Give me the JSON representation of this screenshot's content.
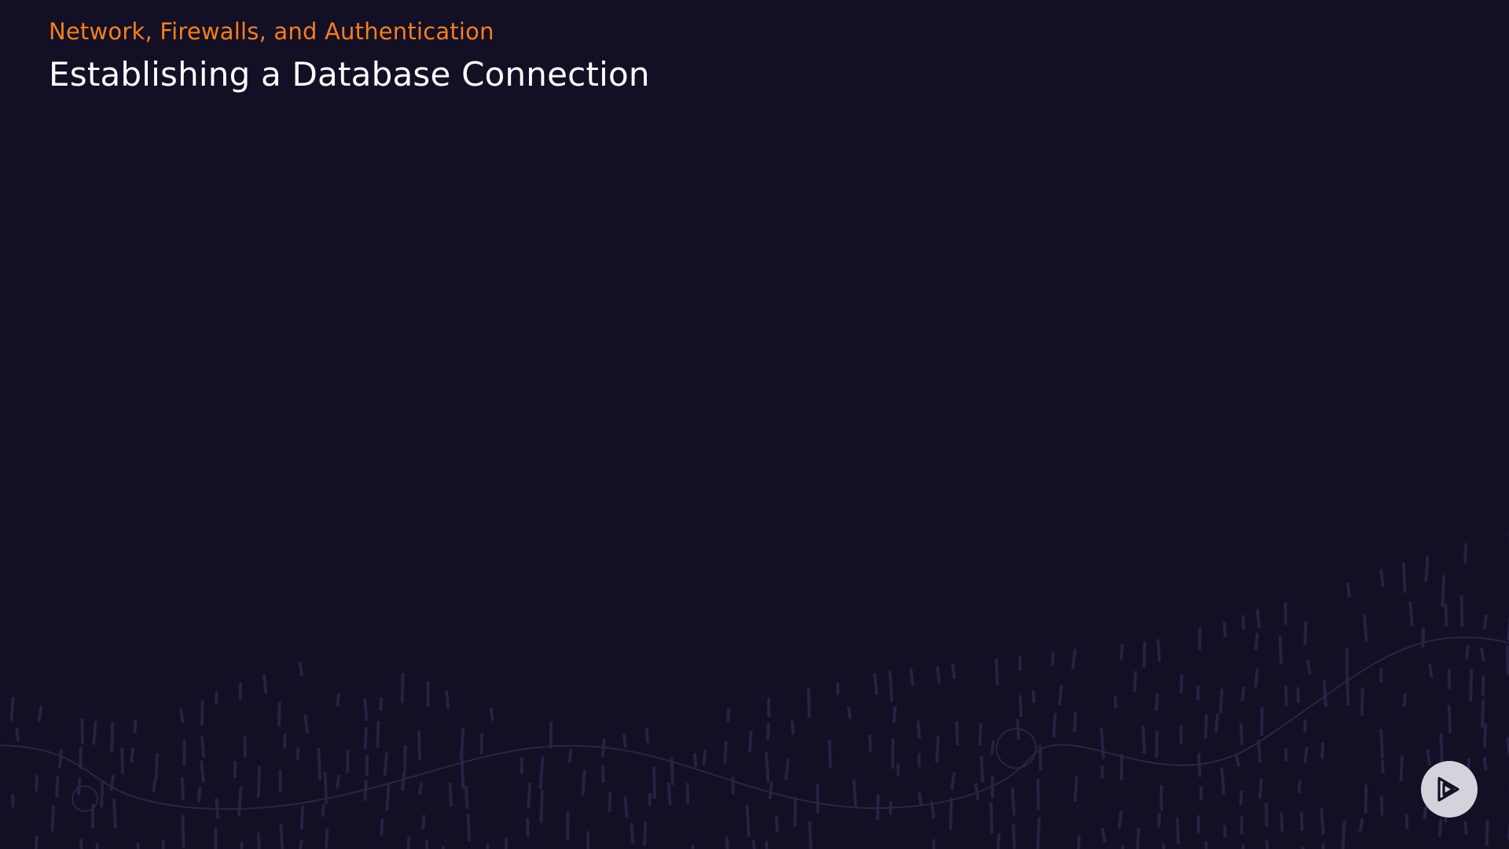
{
  "slide": {
    "module_title": "Network, Firewalls, and Authentication",
    "clip_title": "Establishing a Database Connection"
  },
  "branding": {
    "logo_icon": "play-logo-icon"
  },
  "colors": {
    "background": "#130f24",
    "accent": "#f57e1e",
    "title": "#ffffff",
    "decoration": "#2a2545"
  }
}
